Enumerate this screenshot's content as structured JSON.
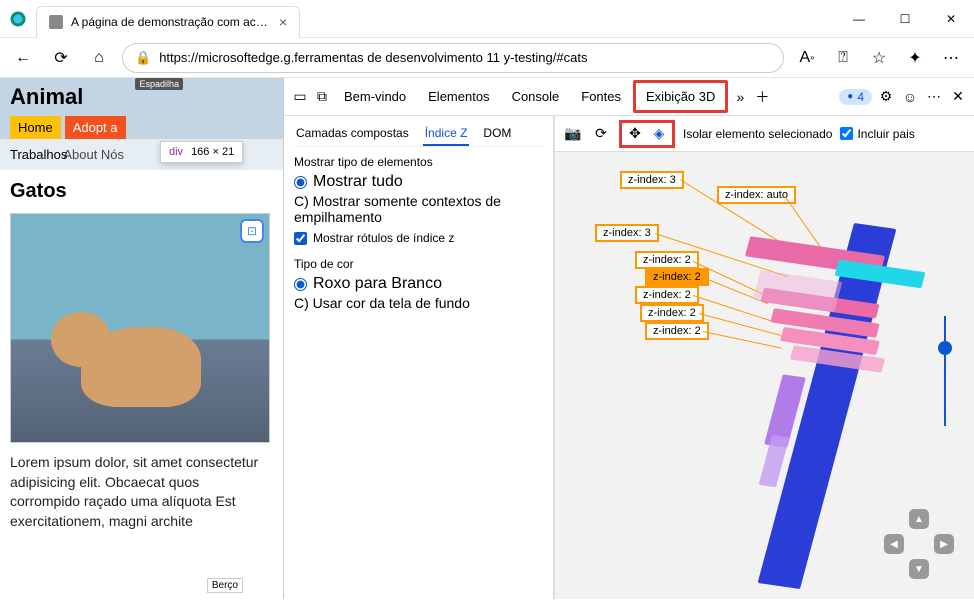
{
  "window": {
    "tab_title": "A página de demonstração com acessibilidade é",
    "url": "https://microsoftedge.g.ferramentas de desenvolvimento 11 y-testing/#cats"
  },
  "page": {
    "site_title": "Animal",
    "nav_home": "Home",
    "nav_adopt": "Adopt a",
    "nav_trabalhos": "Trabalhos",
    "nav_about_nos": "About  Nós",
    "small_tooltip": "Espadilha",
    "dim_tag": "div",
    "dim_size": "166 × 21",
    "section_title": "Gatos",
    "lorem": "Lorem ipsum dolor, sit amet consectetur adipisicing elit. Obcaecat quos corrompido raçado uma alíquota Est exercitationem, magni archite",
    "float_label": "Berço"
  },
  "devtools": {
    "tabs": {
      "bemvindo": "Bem-vindo",
      "elementos": "Elementos",
      "console": "Console",
      "fontes": "Fontes",
      "exibicao3d": "Exibição 3D"
    },
    "issues_count": "4",
    "subtabs": {
      "camadas": "Camadas compostas",
      "indicez": "Índice Z",
      "dom": "DOM"
    },
    "panel": {
      "group1_title": "Mostrar tipo de elementos",
      "opt_show_all": "Mostrar tudo",
      "opt_show_stacking": "C) Mostrar somente contextos de empilhamento",
      "chk_show_labels": "Mostrar rótulos de índice z",
      "group2_title": "Tipo de cor",
      "opt_purple_white": "Roxo para Branco",
      "opt_bg_color": "C) Usar cor da tela de fundo"
    },
    "toolbar3d": {
      "isolate": "Isolar elemento selecionado",
      "include_parents": "Incluir pais"
    },
    "zlabels": [
      "z-index: 3",
      "z-index: auto",
      "z-index: 3",
      "z-index: 2",
      "z-index: 2",
      "z-index: 2",
      "z-index: 2",
      "z-index: 2"
    ]
  }
}
